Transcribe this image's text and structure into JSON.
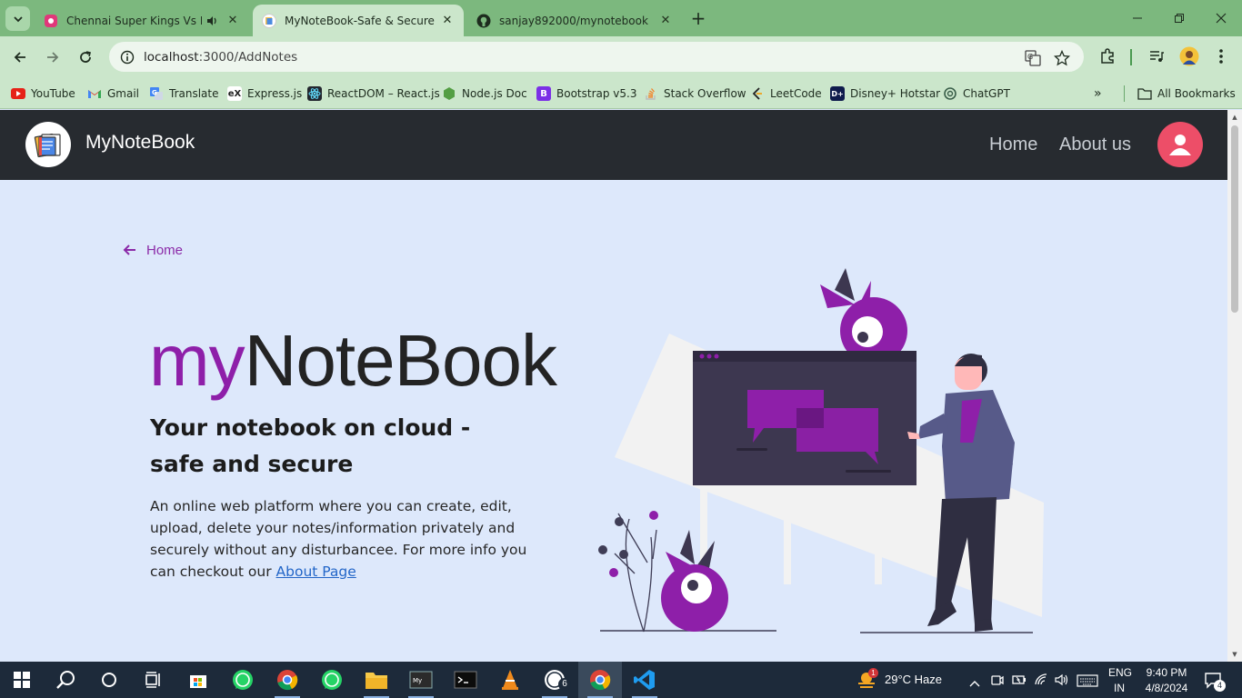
{
  "browser": {
    "tabs": [
      {
        "title": "Chennai Super Kings Vs Kolkata",
        "active": false
      },
      {
        "title": "MyNoteBook-Safe & Secure",
        "active": true
      },
      {
        "title": "sanjay892000/mynotebook",
        "active": false
      }
    ],
    "url_host": "localhost",
    "url_path": ":3000/AddNotes",
    "bookmarks": [
      {
        "label": "YouTube",
        "icon": "youtube-icon"
      },
      {
        "label": "Gmail",
        "icon": "gmail-icon"
      },
      {
        "label": "Translate",
        "icon": "translate-icon"
      },
      {
        "label": "Express.js",
        "icon": "express-icon"
      },
      {
        "label": "ReactDOM – React.js",
        "icon": "react-icon"
      },
      {
        "label": "Node.js Doc",
        "icon": "nodejs-icon"
      },
      {
        "label": "Bootstrap v5.3",
        "icon": "bootstrap-icon"
      },
      {
        "label": "Stack Overflow",
        "icon": "stackoverflow-icon"
      },
      {
        "label": "LeetCode",
        "icon": "leetcode-icon"
      },
      {
        "label": "Disney+ Hotstar",
        "icon": "hotstar-icon"
      },
      {
        "label": "ChatGPT",
        "icon": "chatgpt-icon"
      }
    ],
    "all_bookmarks_label": "All Bookmarks"
  },
  "app": {
    "brand": "MyNoteBook",
    "nav": {
      "home": "Home",
      "about": "About us"
    },
    "back_label": "Home",
    "hero": {
      "title_part1": "my",
      "title_part2": "NoteBook",
      "subtitle": "Your notebook on cloud - safe and secure",
      "description": "An online web platform where you can create, edit, upload, delete your notes/information privately and securely without any disturbancee. For more info you can checkout our ",
      "link_text": "About Page"
    }
  },
  "colors": {
    "accent": "#8e1fa9",
    "navbar": "#272b30",
    "page_bg": "#dde8fb",
    "avatar": "#ed4e68",
    "browser_frame": "#7cb87e"
  },
  "taskbar": {
    "weather_badge": "1",
    "weather": "29°C  Haze",
    "lang_top": "ENG",
    "lang_bottom": "IN",
    "time": "9:40 PM",
    "date": "4/8/2024",
    "whatsapp_badge": "6",
    "notification_count": "4"
  }
}
